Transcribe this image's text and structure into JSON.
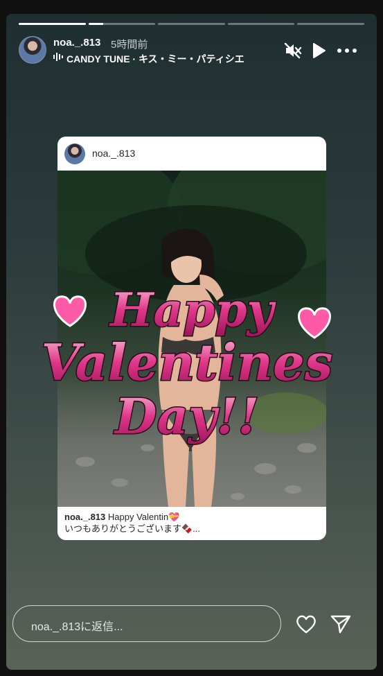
{
  "story": {
    "username": "noa._.813",
    "time": "5時間前",
    "music": "CANDY TUNE · キス・ミー・パティシエ",
    "progress": [
      1.0,
      0.22,
      0,
      0,
      0
    ]
  },
  "post": {
    "username": "noa._.813",
    "caption_user": "noa._.813",
    "caption_line1": "Happy Valentin💝",
    "caption_line2": "いつもありがとうございます🍫..."
  },
  "overlay_text": {
    "line1": "Happy",
    "line2": "Valentines",
    "line3": "Day!!"
  },
  "reply": {
    "placeholder": "noa._.813に返信..."
  },
  "colors": {
    "text_pink": "#e0378a",
    "heart_pink": "#ff5aa8"
  }
}
